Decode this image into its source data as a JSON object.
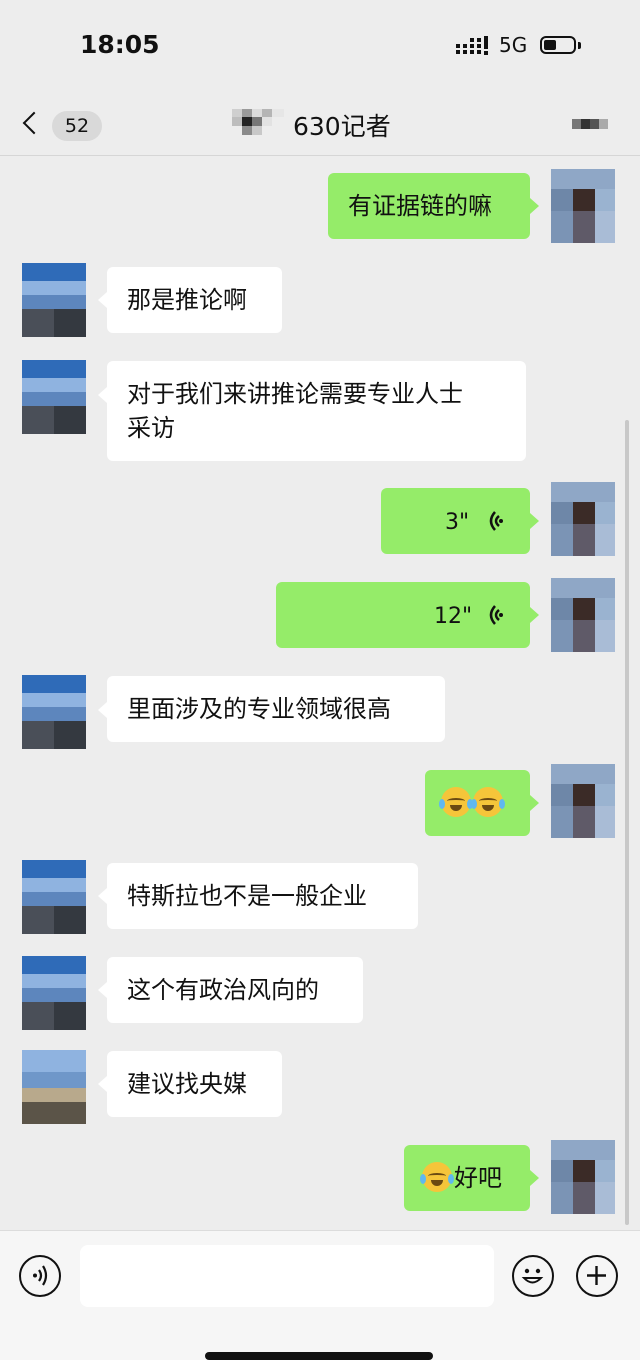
{
  "status_bar": {
    "time": "18:05",
    "network": "5G"
  },
  "nav": {
    "back_count": "52",
    "title": "630记者"
  },
  "messages": [
    {
      "id": "m1",
      "side": "right",
      "type": "text",
      "text": "有证据链的嘛"
    },
    {
      "id": "m2",
      "side": "left",
      "type": "text",
      "text": "那是推论啊"
    },
    {
      "id": "m3",
      "side": "left",
      "type": "text",
      "lines": [
        "对于我们来讲推论需要专业人士",
        "采访"
      ]
    },
    {
      "id": "m4",
      "side": "right",
      "type": "voice",
      "duration": "3\""
    },
    {
      "id": "m5",
      "side": "right",
      "type": "voice",
      "duration": "12\""
    },
    {
      "id": "m6",
      "side": "left",
      "type": "text",
      "text": "里面涉及的专业领域很高"
    },
    {
      "id": "m7",
      "side": "right",
      "type": "emoji",
      "emoji": [
        "crying-laughing-emoji",
        "crying-laughing-emoji"
      ]
    },
    {
      "id": "m8",
      "side": "left",
      "type": "text",
      "text": "特斯拉也不是一般企业"
    },
    {
      "id": "m9",
      "side": "left",
      "type": "text",
      "text": "这个有政治风向的"
    },
    {
      "id": "m10",
      "side": "left",
      "type": "text",
      "text": "建议找央媒"
    },
    {
      "id": "m11",
      "side": "right",
      "type": "text_emoji",
      "emoji": "crying-laughing-emoji",
      "text": "好吧"
    }
  ],
  "input_bar": {
    "text": "",
    "icons": [
      "voice-icon",
      "emoji-icon",
      "plus-icon"
    ]
  },
  "colors": {
    "background": "#ededed",
    "bubble_right": "#95ec69",
    "bubble_left": "#ffffff"
  }
}
